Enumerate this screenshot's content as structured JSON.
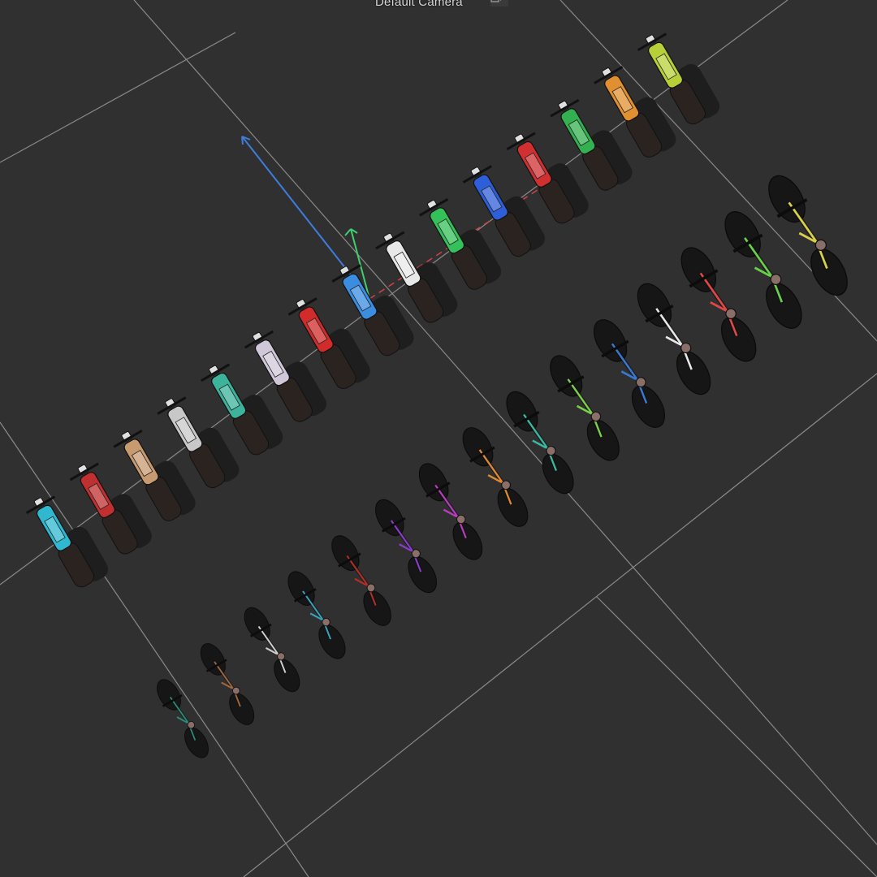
{
  "viewport": {
    "camera_label": "Default Camera",
    "camera_menu_icon": "camera-options-icon"
  },
  "scene": {
    "background": "#303030",
    "grid_color": "#8a8a8a",
    "gizmo": {
      "up_axis_color": "#3f7ddc",
      "forward_axis_color": "#3ecf6f",
      "red_axis_color": "#d64040"
    },
    "motorcycles": [
      "#2fb8d0",
      "#c03030",
      "#c89a70",
      "#c8c8c8",
      "#3cb39a",
      "#d0c8d8",
      "#d22b2b",
      "#3b8de0",
      "#e8e8e8",
      "#35c15a",
      "#2f5fd8",
      "#d23030",
      "#33b050",
      "#e09030",
      "#b8d038"
    ],
    "bicycles": [
      "#2d8c78",
      "#a06840",
      "#cfcfcf",
      "#3aa0b8",
      "#b03028",
      "#8a3cc8",
      "#b83cc0",
      "#e08a30",
      "#3ab8a0",
      "#7ad048",
      "#3a78d0",
      "#e8e8e8",
      "#e04848",
      "#68d048",
      "#d8d048"
    ]
  }
}
